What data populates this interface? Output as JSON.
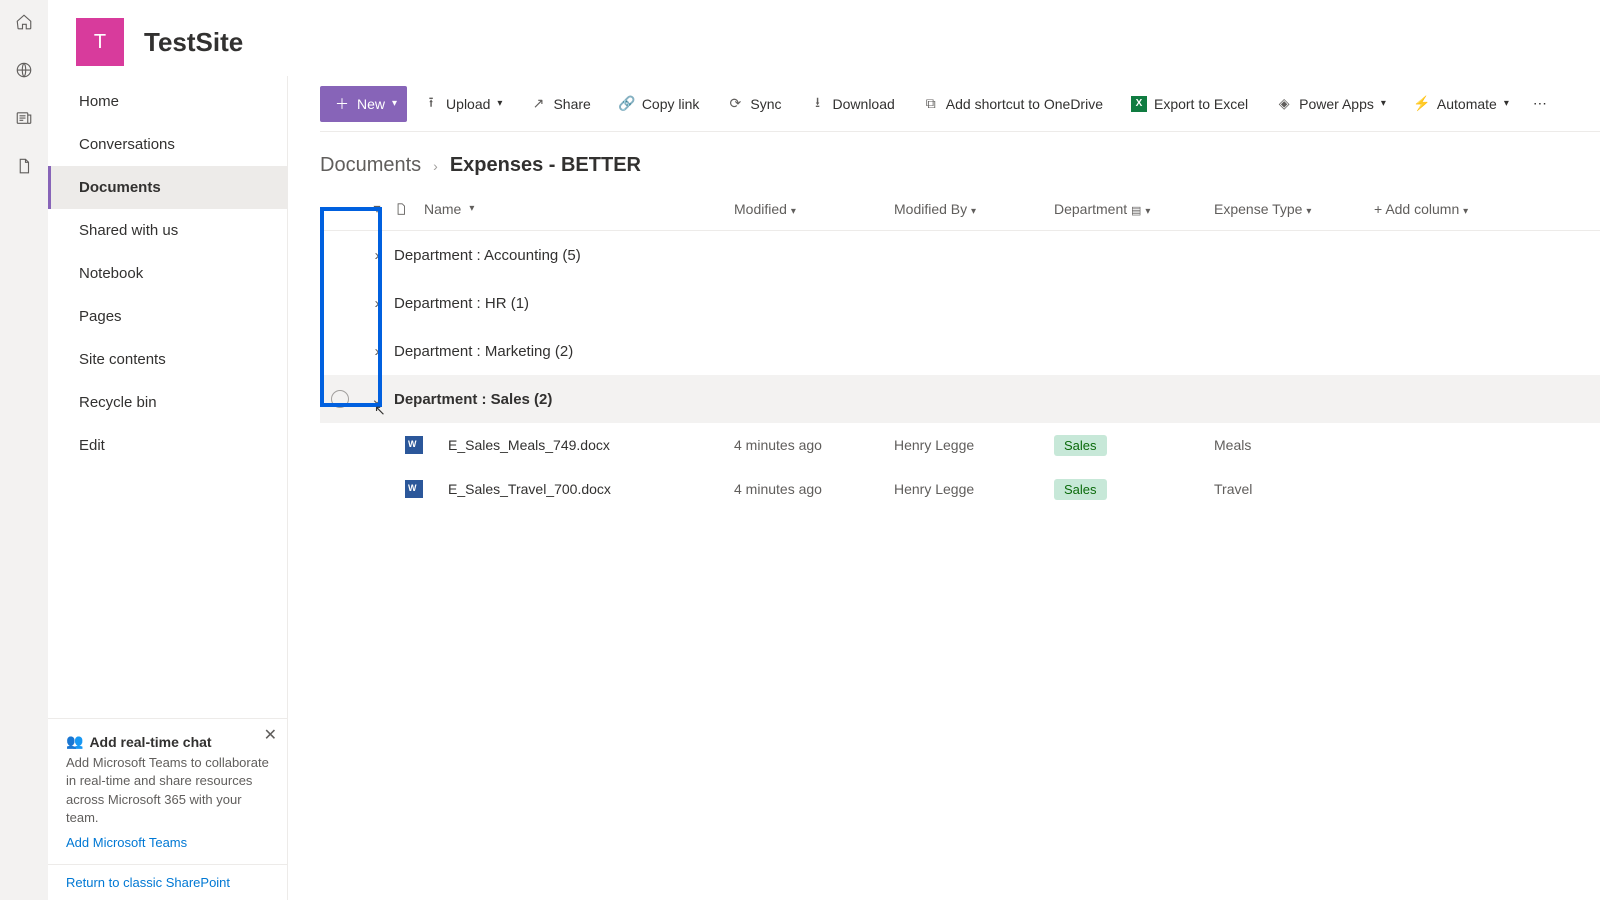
{
  "site": {
    "tile_letter": "T",
    "name": "TestSite"
  },
  "nav": {
    "items": [
      "Home",
      "Conversations",
      "Documents",
      "Shared with us",
      "Notebook",
      "Pages",
      "Site contents",
      "Recycle bin",
      "Edit"
    ],
    "active_index": 2
  },
  "promo": {
    "title": "Add real-time chat",
    "body": "Add Microsoft Teams to collaborate in real-time and share resources across Microsoft 365 with your team.",
    "link": "Add Microsoft Teams"
  },
  "classic_link": "Return to classic SharePoint",
  "commands": {
    "new": "New",
    "upload": "Upload",
    "share": "Share",
    "copylink": "Copy link",
    "sync": "Sync",
    "download": "Download",
    "shortcut": "Add shortcut to OneDrive",
    "export": "Export to Excel",
    "powerapps": "Power Apps",
    "automate": "Automate"
  },
  "breadcrumb": {
    "root": "Documents",
    "folder": "Expenses - BETTER"
  },
  "columns": {
    "name": "Name",
    "modified": "Modified",
    "modified_by": "Modified By",
    "department": "Department",
    "expense_type": "Expense Type",
    "add": "Add column"
  },
  "groups": [
    {
      "label": "Department : Accounting (5)",
      "expanded": false,
      "hover": false
    },
    {
      "label": "Department : HR (1)",
      "expanded": false,
      "hover": false
    },
    {
      "label": "Department : Marketing (2)",
      "expanded": false,
      "hover": false
    },
    {
      "label": "Department : Sales (2)",
      "expanded": true,
      "hover": true
    }
  ],
  "rows": [
    {
      "name": "E_Sales_Meals_749.docx",
      "modified": "4 minutes ago",
      "modified_by": "Henry Legge",
      "department": "Sales",
      "expense_type": "Meals"
    },
    {
      "name": "E_Sales_Travel_700.docx",
      "modified": "4 minutes ago",
      "modified_by": "Henry Legge",
      "department": "Sales",
      "expense_type": "Travel"
    }
  ]
}
